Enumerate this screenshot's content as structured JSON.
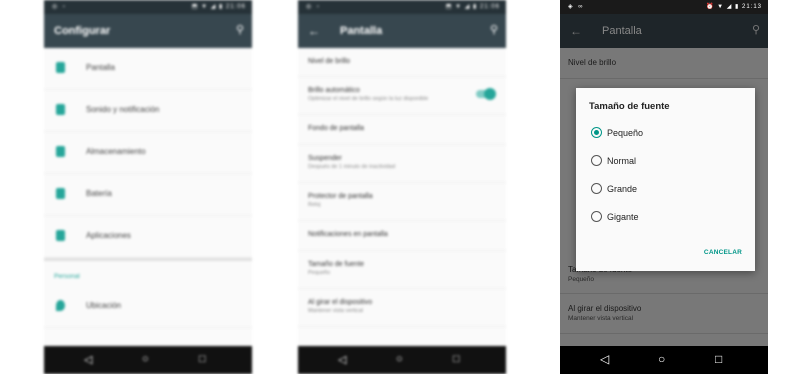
{
  "status_time_blurred": "21:06",
  "status_time": "21:13",
  "screen1": {
    "title": "Configurar",
    "items": [
      "Pantalla",
      "Sonido y notificación",
      "Almacenamiento",
      "Batería",
      "Aplicaciones"
    ],
    "section": "Personal",
    "items2": [
      "Ubicación"
    ]
  },
  "screen2": {
    "title": "Pantalla",
    "items": [
      {
        "title": "Nivel de brillo",
        "sub": ""
      },
      {
        "title": "Brillo automático",
        "sub": "Optimizar el nivel de brillo según la luz disponible"
      },
      {
        "title": "Fondo de pantalla",
        "sub": ""
      },
      {
        "title": "Suspender",
        "sub": "Después de 1 minuto de inactividad"
      },
      {
        "title": "Protector de pantalla",
        "sub": "Reloj"
      },
      {
        "title": "Notificaciones en pantalla",
        "sub": ""
      },
      {
        "title": "Tamaño de fuente",
        "sub": "Pequeño"
      },
      {
        "title": "Al girar el dispositivo",
        "sub": "Mantener vista vertical"
      }
    ]
  },
  "screen3": {
    "title": "Pantalla",
    "bg_items": {
      "nivel": "Nivel de brillo",
      "tamano": "Tamaño de fuente",
      "tamano_sub": "Pequeño",
      "girar": "Al girar el dispositivo",
      "girar_sub": "Mantener vista vertical"
    },
    "dialog": {
      "title": "Tamaño de fuente",
      "options": [
        "Pequeño",
        "Normal",
        "Grande",
        "Gigante"
      ],
      "selected": "Pequeño",
      "cancel": "CANCELAR"
    }
  },
  "colors": {
    "accent": "#009688",
    "toolbar": "#37474f"
  }
}
